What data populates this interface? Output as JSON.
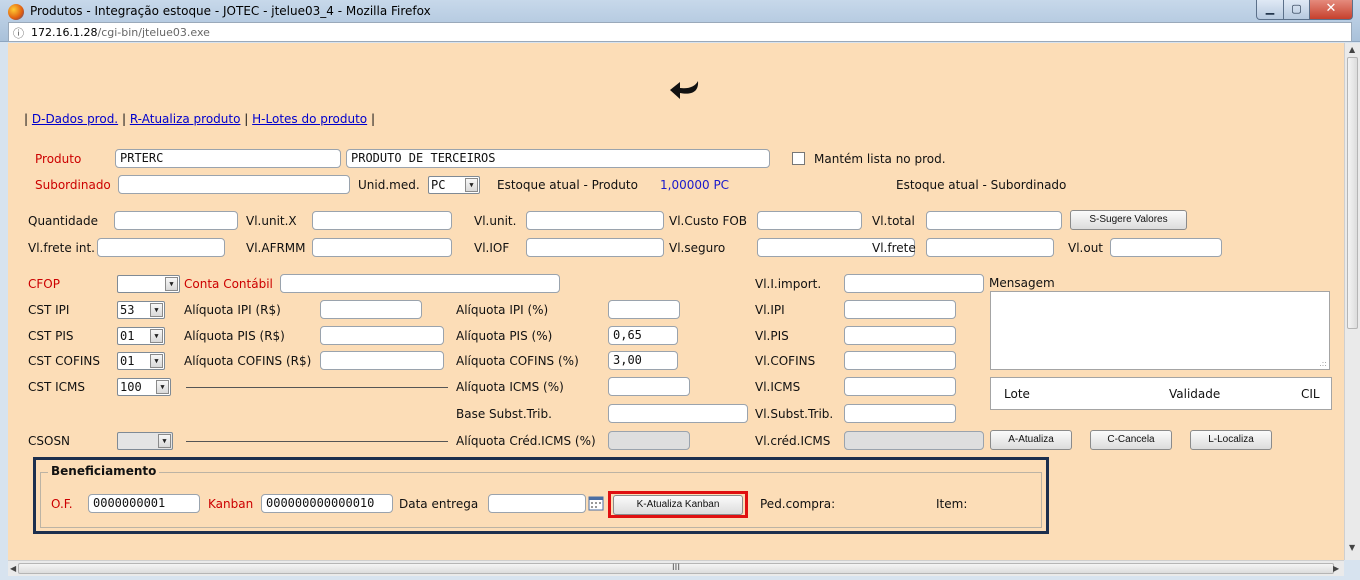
{
  "window": {
    "title": "Produtos - Integração estoque - JOTEC - jtelue03_4 - Mozilla Firefox"
  },
  "address": {
    "host": "172.16.1.28",
    "path": "/cgi-bin/jtelue03.exe"
  },
  "icons": [
    "firefox-icon",
    "info-icon",
    "back-arrow-icon",
    "calendar-icon",
    "resize-grip-icon"
  ],
  "nav": {
    "sep": "|",
    "links": [
      "D-Dados prod.",
      "R-Atualiza produto",
      "H-Lotes do produto"
    ]
  },
  "product": {
    "produto_label": "Produto",
    "produto_code": "PRTERC",
    "produto_desc": "PRODUTO DE TERCEIROS",
    "mantem_label": "Mantém lista no prod.",
    "subordinado_label": "Subordinado",
    "subordinado_value": "",
    "unid_label": "Unid.med.",
    "unid_value": "PC",
    "estoque_prod_label": "Estoque atual - Produto",
    "estoque_prod_value": "1,00000 PC",
    "estoque_sub_label": "Estoque atual - Subordinado"
  },
  "values": {
    "quantidade": "Quantidade",
    "vl_unit_x": "Vl.unit.X",
    "vl_unit": "Vl.unit.",
    "vl_custo_fob": "Vl.Custo FOB",
    "vl_total": "Vl.total",
    "sugere_btn": "S-Sugere Valores",
    "vl_frete_int": "Vl.frete int.",
    "vl_afrmm": "Vl.AFRMM",
    "vl_iof": "Vl.IOF",
    "vl_seguro": "Vl.seguro",
    "vl_frete": "Vl.frete",
    "vl_out": "Vl.out"
  },
  "tax": {
    "cfop": "CFOP",
    "conta_contabil": "Conta Contábil",
    "vl_i_import": "Vl.I.import.",
    "mensagem": "Mensagem",
    "cst_ipi": "CST IPI",
    "cst_ipi_value": "53",
    "aliq_ipi_rs": "Alíquota IPI (R$)",
    "aliq_ipi_pct": "Alíquota IPI (%)",
    "vl_ipi": "Vl.IPI",
    "cst_pis": "CST PIS",
    "cst_pis_value": "01",
    "aliq_pis_rs": "Alíquota PIS (R$)",
    "aliq_pis_pct": "Alíquota PIS (%)",
    "aliq_pis_pct_value": "0,65",
    "vl_pis": "Vl.PIS",
    "cst_cofins": "CST COFINS",
    "cst_cofins_value": "01",
    "aliq_cofins_rs": "Alíquota COFINS (R$)",
    "aliq_cofins_pct": "Alíquota COFINS (%)",
    "aliq_cofins_pct_value": "3,00",
    "vl_cofins": "Vl.COFINS",
    "cst_icms": "CST ICMS",
    "cst_icms_value": "100",
    "aliq_icms_pct": "Alíquota ICMS (%)",
    "vl_icms": "Vl.ICMS",
    "base_subst": "Base Subst.Trib.",
    "vl_subst": "Vl.Subst.Trib.",
    "csosn": "CSOSN",
    "aliq_cred_icms": "Alíquota Créd.ICMS (%)",
    "vl_cred_icms": "Vl.créd.ICMS"
  },
  "lote_table": {
    "columns": [
      "Lote",
      "Validade",
      "CIL"
    ]
  },
  "actions": {
    "atualiza": "A-Atualiza",
    "cancela": "C-Cancela",
    "localiza": "L-Localiza"
  },
  "beneficiamento": {
    "title": "Beneficiamento",
    "of_label": "O.F.",
    "of_value": "0000000001",
    "kanban_label": "Kanban",
    "kanban_value": "000000000000010",
    "data_entrega_label": "Data entrega",
    "data_entrega_value": "",
    "kanban_btn": "K-Atualiza Kanban",
    "ped_compra_label": "Ped.compra:",
    "item_label": "Item:"
  },
  "scroll": {
    "hthumb_grip": "III"
  }
}
